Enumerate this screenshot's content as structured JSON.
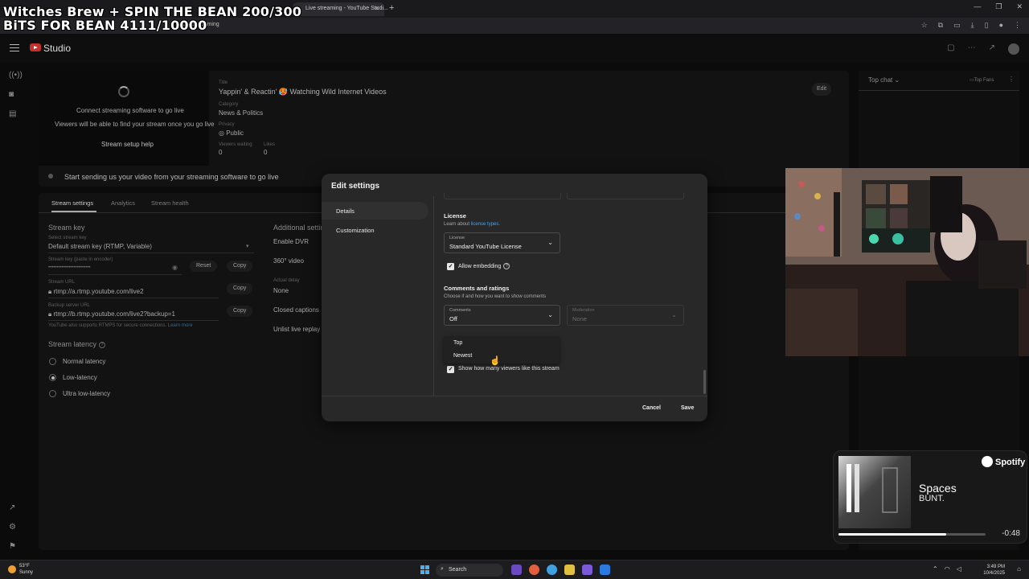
{
  "overlay": {
    "line1": "Witches Brew + SPIN THE BEAN 200/300",
    "line2": "BiTS FOR BEAN 4111/10000"
  },
  "browser": {
    "active_tab": "Live streaming - YouTube Studi...",
    "url": "k/livestreaming"
  },
  "studio": {
    "brand": "Studio"
  },
  "stream_preview": {
    "connect_text": "Connect streaming software to go live",
    "viewers_text": "Viewers will be able to find your stream once you go live",
    "setup_help": "Stream setup help",
    "status": "Start sending us your video from your streaming software to go live"
  },
  "stream_info": {
    "title_label": "Title",
    "title": "Yappin' & Reactin' 🥵 Watching Wild Internet Videos",
    "category_label": "Category",
    "category": "News & Politics",
    "privacy_label": "Privacy",
    "privacy": "Public",
    "viewers_waiting_label": "Viewers waiting",
    "viewers_waiting": "0",
    "likes_label": "Likes",
    "likes": "0",
    "edit": "Edit"
  },
  "tabs": {
    "stream_settings": "Stream settings",
    "analytics": "Analytics",
    "stream_health": "Stream health"
  },
  "stream_key": {
    "heading": "Stream key",
    "select_label": "Select stream key",
    "select_value": "Default stream key (RTMP, Variable)",
    "key_label": "Stream key (paste in encoder)",
    "key_value": "•••••••••••••••••••••••••",
    "reset": "Reset",
    "copy": "Copy",
    "url_label": "Stream URL",
    "url_value": "rtmp://a.rtmp.youtube.com/live2",
    "backup_label": "Backup server URL",
    "backup_value": "rtmp://b.rtmp.youtube.com/live2?backup=1",
    "rtmps_note": "YouTube also supports RTMPS for secure connections.",
    "learn_more": "Learn more"
  },
  "latency": {
    "heading": "Stream latency",
    "normal": "Normal latency",
    "low": "Low-latency",
    "ultra": "Ultra low-latency"
  },
  "additional": {
    "heading": "Additional settings",
    "dvr": "Enable DVR",
    "video360": "360° video",
    "delay_label": "Actual delay",
    "delay_value": "None",
    "captions": "Closed captions",
    "unlist": "Unlist live replay"
  },
  "chat": {
    "top_chat": "Top chat",
    "top_fans": "Top Fans"
  },
  "modal": {
    "title": "Edit settings",
    "nav_details": "Details",
    "nav_customization": "Customization",
    "license_heading": "License",
    "license_sub_prefix": "Learn about ",
    "license_link": "license types.",
    "license_select_label": "License",
    "license_select_value": "Standard YouTube License",
    "allow_embedding": "Allow embedding",
    "comments_heading": "Comments and ratings",
    "comments_sub": "Choose if and how you want to show comments",
    "comments_label": "Comments",
    "comments_value": "Off",
    "moderation_label": "Moderation",
    "moderation_value": "None",
    "dropdown_options": [
      "Top",
      "Newest"
    ],
    "show_viewers": "Show how many viewers like this stream",
    "cancel": "Cancel",
    "save": "Save"
  },
  "spotify": {
    "brand": "Spotify",
    "song": "Spaces",
    "artist": "BUNT.",
    "time_remaining": "-0:48",
    "progress": 0.73
  },
  "taskbar": {
    "weather_temp": "53°F",
    "weather_cond": "Sunny",
    "search": "Search",
    "time": "3:49 PM",
    "date": "10/4/2025"
  },
  "colors": {
    "accent_blue": "#3ea6ff",
    "youtube_red": "#c4302b"
  }
}
